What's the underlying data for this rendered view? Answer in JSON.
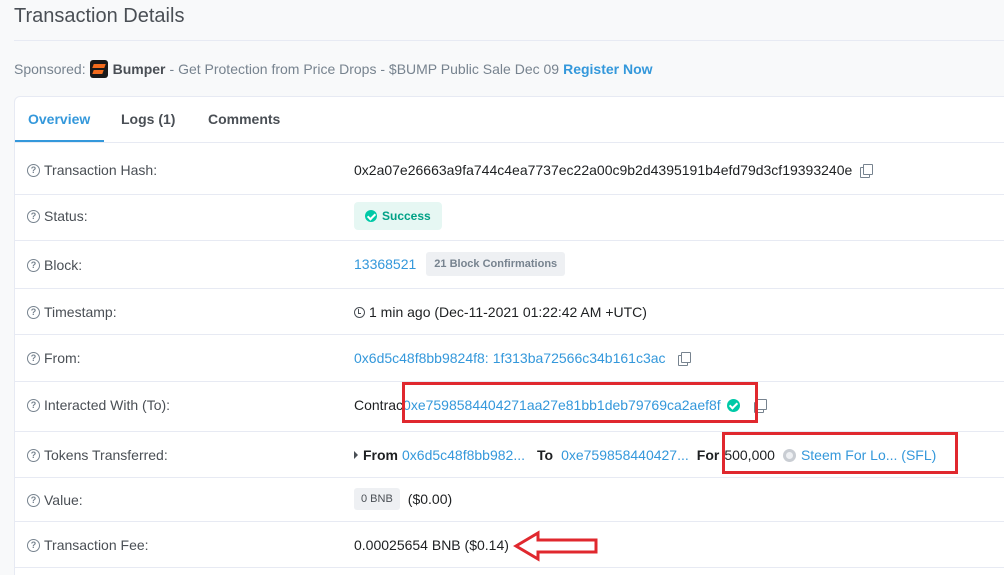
{
  "page": {
    "title": "Transaction Details"
  },
  "sponsor": {
    "prefix": "Sponsored:",
    "brand": "Bumper",
    "text": "- Get Protection from Price Drops - $BUMP Public Sale Dec 09",
    "link": "Register Now"
  },
  "tabs": [
    {
      "label": "Overview",
      "active": true
    },
    {
      "label": "Logs (1)",
      "active": false
    },
    {
      "label": "Comments",
      "active": false
    }
  ],
  "fields": {
    "tx_hash": {
      "label": "Transaction Hash:",
      "value": "0x2a07e26663a9fa744c4ea7737ec22a00c9b2d4395191b4efd79d3cf19393240e"
    },
    "status": {
      "label": "Status:",
      "value": "Success"
    },
    "block": {
      "label": "Block:",
      "value": "13368521",
      "confirmations": "21 Block Confirmations"
    },
    "timestamp": {
      "label": "Timestamp:",
      "value": "1 min ago (Dec-11-2021 01:22:42 AM +UTC)"
    },
    "from": {
      "label": "From:",
      "value_a": "0x6d5c48f8bb9824f8:",
      "value_b": "1f313ba72566c34b161c3ac"
    },
    "interacted": {
      "label": "Interacted With (To):",
      "prefix": "Contrac",
      "address": "0xe759858440",
      "address_b": "4271aa27e81bb1deb79769ca2aef8f"
    },
    "tokens": {
      "label": "Tokens Transferred:",
      "from_label": "From",
      "from_addr": "0x6d5c48f8bb982...",
      "to_label": "To",
      "to_addr": "0xe759858440427...",
      "for_label": "For",
      "amount": "500,000",
      "token": "Steem For Lo... (SFL)"
    },
    "value": {
      "label": "Value:",
      "badge": "0 BNB",
      "usd": "($0.00)"
    },
    "fee": {
      "label": "Transaction Fee:",
      "value": "0.00025654 BNB ($0.14)"
    }
  },
  "colors": {
    "accent": "#3498db",
    "success": "#00c9a7",
    "highlight": "#e0282e"
  }
}
